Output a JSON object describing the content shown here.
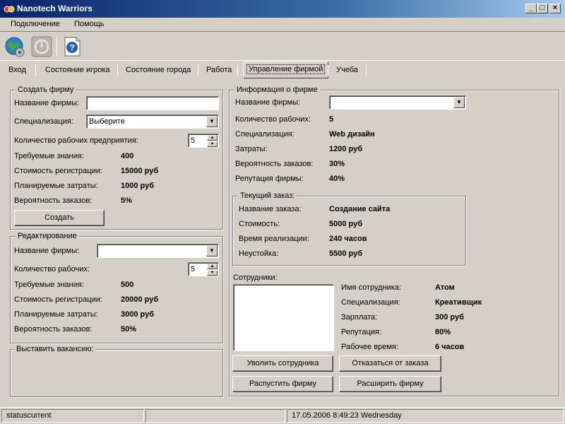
{
  "window": {
    "title": "Nanotech Warriors",
    "minimize": "_",
    "maximize": "□",
    "close": "×"
  },
  "menu": {
    "items": [
      "Подключение",
      "Помощь"
    ]
  },
  "tabs": [
    "Вход",
    "Состояние игрока",
    "Состояние города",
    "Работа",
    "Управление фирмой",
    "Учеба"
  ],
  "create_firm": {
    "legend": "Создать фирму",
    "name_label": "Название фирмы:",
    "name_value": "",
    "spec_label": "Специализация:",
    "spec_value": "Выберите",
    "workers_label": "Количество рабочих предприятия:",
    "workers_value": "5",
    "knowledge_label": "Требуемые знания:",
    "knowledge_value": "400",
    "reg_cost_label": "Стоимость регистрации:",
    "reg_cost_value": "15000 руб",
    "planned_label": "Планируемые затраты:",
    "planned_value": "1000 руб",
    "prob_label": "Вероятность заказов:",
    "prob_value": "5%",
    "create_button": "Создать"
  },
  "edit_firm": {
    "legend": "Редактирование",
    "name_label": "Название фирмы:",
    "name_value": "",
    "workers_label": "Количество рабочих:",
    "workers_value": "5",
    "knowledge_label": "Требуемые знания:",
    "knowledge_value": "500",
    "reg_cost_label": "Стоимость регистрации:",
    "reg_cost_value": "20000 руб",
    "planned_label": "Планируемые затраты:",
    "planned_value": "3000 руб",
    "prob_label": "Вероятность заказов:",
    "prob_value": "50%"
  },
  "vacancy": {
    "legend": "Выставить вакансию:"
  },
  "firm_info": {
    "legend": "Информация о фирме",
    "name_label": "Название фирмы:",
    "name_value": "",
    "workers_label": "Количество рабочих:",
    "workers_value": "5",
    "spec_label": "Специализация:",
    "spec_value": "Web дизайн",
    "costs_label": "Затраты:",
    "costs_value": "1200 руб",
    "prob_label": "Вероятность заказов:",
    "prob_value": "30%",
    "rep_label": "Репутация фирмы:",
    "rep_value": "40%"
  },
  "current_order": {
    "legend": "Текущий заказ:",
    "name_label": "Название заказа:",
    "name_value": "Создание сайта",
    "cost_label": "Стоимость:",
    "cost_value": "5000 руб",
    "time_label": "Время реализации:",
    "time_value": "240 часов",
    "penalty_label": "Неустойка:",
    "penalty_value": "5500 руб"
  },
  "employees": {
    "label": "Сотрудники:",
    "name_label": "Имя сотрудника:",
    "name_value": "Атом",
    "spec_label": "Специализация:",
    "spec_value": "Креативщик",
    "salary_label": "Зарплата:",
    "salary_value": "300 руб",
    "rep_label": "Репутация:",
    "rep_value": "80%",
    "hours_label": "Рабочее время:",
    "hours_value": "6 часов"
  },
  "actions": {
    "fire": "Уволить сотрудника",
    "refuse": "Отказаться от заказа",
    "dissolve": "Распустить фирму",
    "expand": "Расширить фирму"
  },
  "status": {
    "left": "statuscurrent",
    "middle": "",
    "datetime": "17.05.2006 8:49:23  Wednesday"
  }
}
